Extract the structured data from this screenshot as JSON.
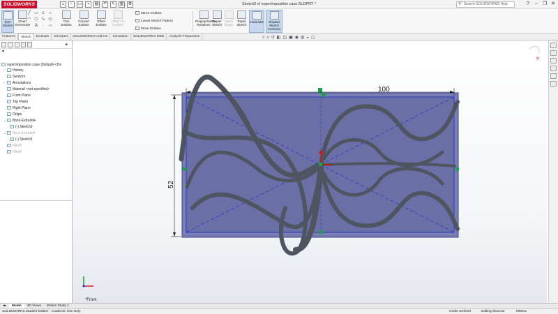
{
  "app": {
    "logo": "SOLIDWORKS",
    "window_title": "Sketch3 of superimposition case.SLDPRT *",
    "search_placeholder": "Search SOLIDWORKS Help"
  },
  "ribbon": {
    "exit_sketch": "Exit Sketch",
    "smart_dimension": "Smart Dimension",
    "trim_entities": "Trim Entities",
    "convert_entities": "Convert Entities",
    "offset_entities": "Offset Entities",
    "offset_on_surface": "Offset On Surface",
    "mirror_entities": "Mirror Entities",
    "linear_sketch_pattern": "Linear Sketch Pattern",
    "move_entities": "Move Entities",
    "display_delete_relations": "Display/Delete Relations",
    "repair_sketch": "Repair Sketch",
    "quick_snaps": "Quick Snaps",
    "rapid_sketch": "Rapid Sketch",
    "instant2d": "Instant2D",
    "shaded_sketch_contours": "Shaded Sketch Contours"
  },
  "tabs": [
    "Features",
    "Sketch",
    "Evaluate",
    "DimXpert",
    "SOLIDWORKS Add-Ins",
    "Simulation",
    "SOLIDWORKS MBD",
    "Analysis Preparation"
  ],
  "tree": {
    "root": "superimposition case  (Default<<De",
    "items": [
      "History",
      "Sensors",
      "Annotations",
      "Material <not specified>",
      "Front Plane",
      "Top Plane",
      "Right Plane",
      "Origin",
      "Boss-Extrude4",
      "(-) Sketch2",
      "Boss-Extrude5",
      "(-) Sketch3",
      "Fillet5",
      "Fillet6"
    ]
  },
  "dimensions": {
    "width": "100",
    "height": "52"
  },
  "view_label": "*Front",
  "bottom_tabs": [
    "Model",
    "3D Views",
    "Motion Study 1"
  ],
  "status": {
    "edition": "SOLIDWORKS Student Edition - Academic Use Only",
    "sketch_state": "Under Defined",
    "editing": "Editing Sketch3",
    "units": "MMGS"
  },
  "colors": {
    "brand": "#c8102e",
    "sketch_blue": "#1f2fd6",
    "part_fill": "#7a7fb2",
    "curve": "#4f5560"
  }
}
